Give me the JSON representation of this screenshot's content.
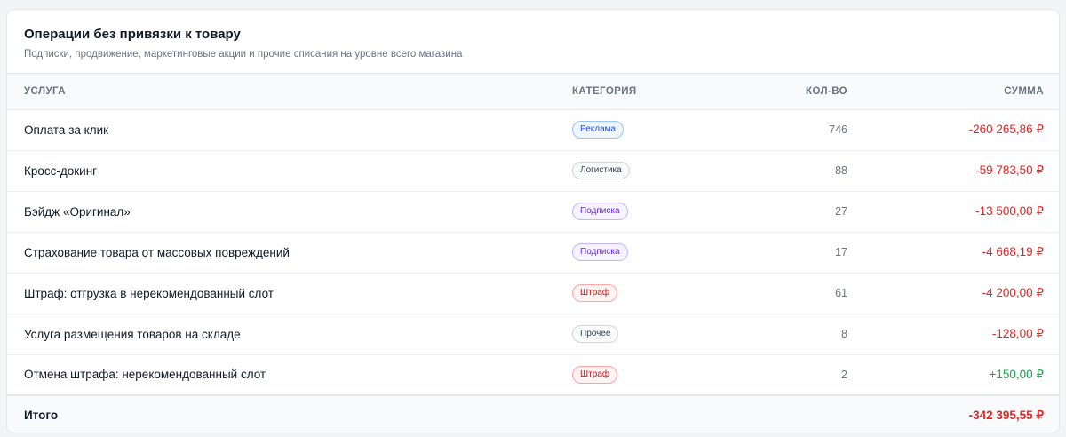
{
  "header": {
    "title": "Операции без привязки к товару",
    "subtitle": "Подписки, продвижение, маркетинговые акции и прочие списания на уровне всего магазина"
  },
  "columns": {
    "service": "УСЛУГА",
    "category": "КАТЕГОРИЯ",
    "qty": "КОЛ-ВО",
    "sum": "СУММА"
  },
  "rows": [
    {
      "service": "Оплата за клик",
      "category": "Реклама",
      "badge": "ads",
      "qty": "746",
      "sum": "-260 265,86 ₽",
      "sign": "negative"
    },
    {
      "service": "Кросс-докинг",
      "category": "Логистика",
      "badge": "logistics",
      "qty": "88",
      "sum": "-59 783,50 ₽",
      "sign": "negative"
    },
    {
      "service": "Бэйдж «Оригинал»",
      "category": "Подписка",
      "badge": "subscription",
      "qty": "27",
      "sum": "-13 500,00 ₽",
      "sign": "negative"
    },
    {
      "service": "Страхование товара от массовых повреждений",
      "category": "Подписка",
      "badge": "subscription",
      "qty": "17",
      "sum": "-4 668,19 ₽",
      "sign": "negative"
    },
    {
      "service": "Штраф: отгрузка в нерекомендованный слот",
      "category": "Штраф",
      "badge": "penalty",
      "qty": "61",
      "sum": "-4 200,00 ₽",
      "sign": "negative"
    },
    {
      "service": "Услуга размещения товаров на складе",
      "category": "Прочее",
      "badge": "other",
      "qty": "8",
      "sum": "-128,00 ₽",
      "sign": "negative"
    },
    {
      "service": "Отмена штрафа: нерекомендованный слот",
      "category": "Штраф",
      "badge": "penalty",
      "qty": "2",
      "sum": "+150,00 ₽",
      "sign": "positive"
    }
  ],
  "total": {
    "label": "Итого",
    "sum": "-342 395,55 ₽",
    "sign": "negative"
  },
  "colors": {
    "negative": "#dc2626",
    "positive": "#16a34a",
    "badges": {
      "ads": {
        "text": "#1d4ed8",
        "bg": "#eff6ff",
        "border": "#93c5fd"
      },
      "logistics": {
        "text": "#374151",
        "bg": "#f9fafb",
        "border": "#d1d5db"
      },
      "subscription": {
        "text": "#6d28d9",
        "bg": "#f5f3ff",
        "border": "#c4b5fd"
      },
      "penalty": {
        "text": "#b91c1c",
        "bg": "#fef2f2",
        "border": "#fca5a5"
      },
      "other": {
        "text": "#374151",
        "bg": "#f9fafb",
        "border": "#d1d5db"
      }
    }
  }
}
